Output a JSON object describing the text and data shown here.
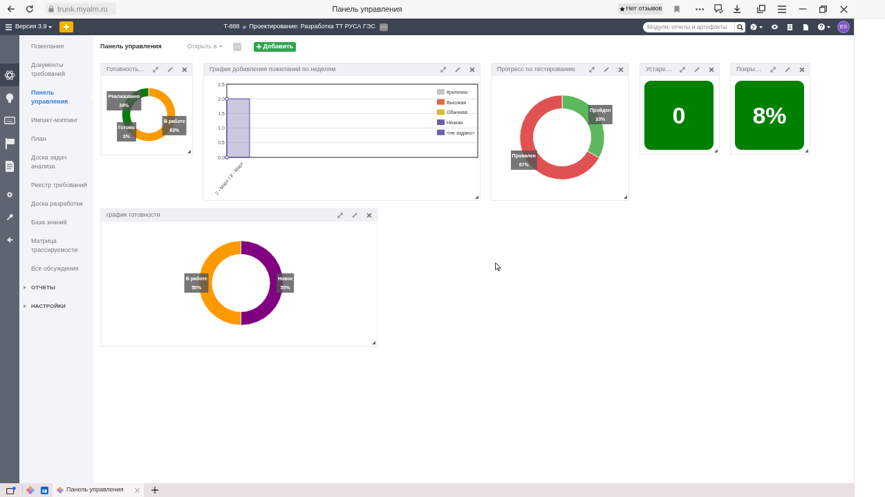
{
  "browser": {
    "url": "trunk.myalm.ru",
    "page_title": "Панель управления",
    "reviews_button": "Нет отзывов"
  },
  "app_header": {
    "version_menu": "Версия 3.9",
    "project_code": "T-888",
    "project_name": "Проектирование: Разработка ТТ РУСА ГЭС",
    "search": {
      "placeholder": "Модули, отчеты и артефакты"
    },
    "avatar": "ES"
  },
  "icon_rail": [
    {
      "selected": true
    },
    {
      "selected": false
    },
    {
      "selected": false
    },
    {
      "selected": false
    },
    {
      "selected": false
    },
    {
      "selected": false
    },
    {
      "selected": false
    },
    {
      "selected": false
    }
  ],
  "sidebar": {
    "items": [
      {
        "kind": "link",
        "label": "Пожелания",
        "selected": false
      },
      {
        "kind": "link",
        "label": "Документы требований",
        "selected": false
      },
      {
        "kind": "link",
        "label": "Панель управления",
        "selected": true
      },
      {
        "kind": "link",
        "label": "Импакт-мэппинг",
        "selected": false
      },
      {
        "kind": "link",
        "label": "План",
        "selected": false
      },
      {
        "kind": "link",
        "label": "Доска задач анализа",
        "selected": false
      },
      {
        "kind": "link",
        "label": "Реестр требований",
        "selected": false
      },
      {
        "kind": "link",
        "label": "Доска разработки",
        "selected": false
      },
      {
        "kind": "link",
        "label": "База знаний",
        "selected": false
      },
      {
        "kind": "link",
        "label": "Матрица трассируемости",
        "selected": false
      },
      {
        "kind": "link",
        "label": "Все обсуждения",
        "selected": false
      },
      {
        "kind": "group",
        "label": "ОТЧЕТЫ",
        "selected": false,
        "expanded": false
      },
      {
        "kind": "group",
        "label": "НАСТРОЙКИ",
        "selected": false,
        "expanded": false
      }
    ]
  },
  "toolbar": {
    "title": "Панель управления",
    "open_in": "Открыть в",
    "add_button": "Добавить"
  },
  "dashboard": {
    "rows": [
      {
        "widgets": [
          {
            "kind": "chart",
            "title": "Готовность…",
            "chart_data": {
              "type": "donut",
              "categories": [
                "В работе",
                "Готово",
                "Реализовано"
              ],
              "values": [
                63,
                3,
                34
              ],
              "colors": [
                "#ff9900",
                "#5e8a22",
                "#0a7a0a"
              ],
              "value_labels": [
                "63%",
                "3%",
                "34%"
              ]
            }
          },
          {
            "kind": "chart",
            "title": "График добавления пожеланий по неделям",
            "chart_data": {
              "type": "bar",
              "categories": [
                "2 - Март / 8 - Март"
              ],
              "series": [
                {
                  "name": "Критично",
                  "color": "#c4c4c4",
                  "values": [
                    0
                  ]
                },
                {
                  "name": "Высокая",
                  "color": "#e0693e",
                  "values": [
                    0
                  ]
                },
                {
                  "name": "Обычная",
                  "color": "#d6bd2e",
                  "values": [
                    0
                  ]
                },
                {
                  "name": "Низкая",
                  "color": "#6b62ad",
                  "values": [
                    0
                  ]
                },
                {
                  "name": "<не задано>",
                  "color": "#6b62ad",
                  "values": [
                    2
                  ]
                }
              ],
              "stacked": true,
              "grid": true,
              "ylim": [
                0,
                2.5
              ],
              "yticks": [
                {
                  "value": 0,
                  "label": "0.0"
                },
                {
                  "value": 0.5,
                  "label": "0.5"
                },
                {
                  "value": 1,
                  "label": "1.0"
                },
                {
                  "value": 1.5,
                  "label": "1.5"
                },
                {
                  "value": 2,
                  "label": "2.0"
                },
                {
                  "value": 2.5,
                  "label": "2.5"
                }
              ]
            }
          },
          {
            "kind": "chart",
            "title": "Прогресс по тестированию",
            "chart_data": {
              "type": "donut",
              "categories": [
                "Пройден",
                "Провален"
              ],
              "values": [
                33,
                67
              ],
              "colors": [
                "#5cb85c",
                "#e05252"
              ],
              "value_labels": [
                "33%",
                "67%"
              ]
            }
          },
          {
            "kind": "kpi",
            "title": "Устаре…",
            "value": "0"
          },
          {
            "kind": "kpi",
            "title": "Покры…",
            "value": "8%"
          }
        ]
      },
      {
        "widgets": [
          {
            "kind": "chart",
            "title": "график готовности",
            "chart_data": {
              "type": "donut",
              "categories": [
                "Новое",
                "В работе"
              ],
              "values": [
                50,
                50
              ],
              "colors": [
                "#800080",
                "#ff9900"
              ],
              "value_labels": [
                "50%",
                "50%"
              ]
            }
          }
        ]
      }
    ]
  },
  "browser_tabs": [
    {
      "title": "Панель управления",
      "selected": true
    }
  ]
}
